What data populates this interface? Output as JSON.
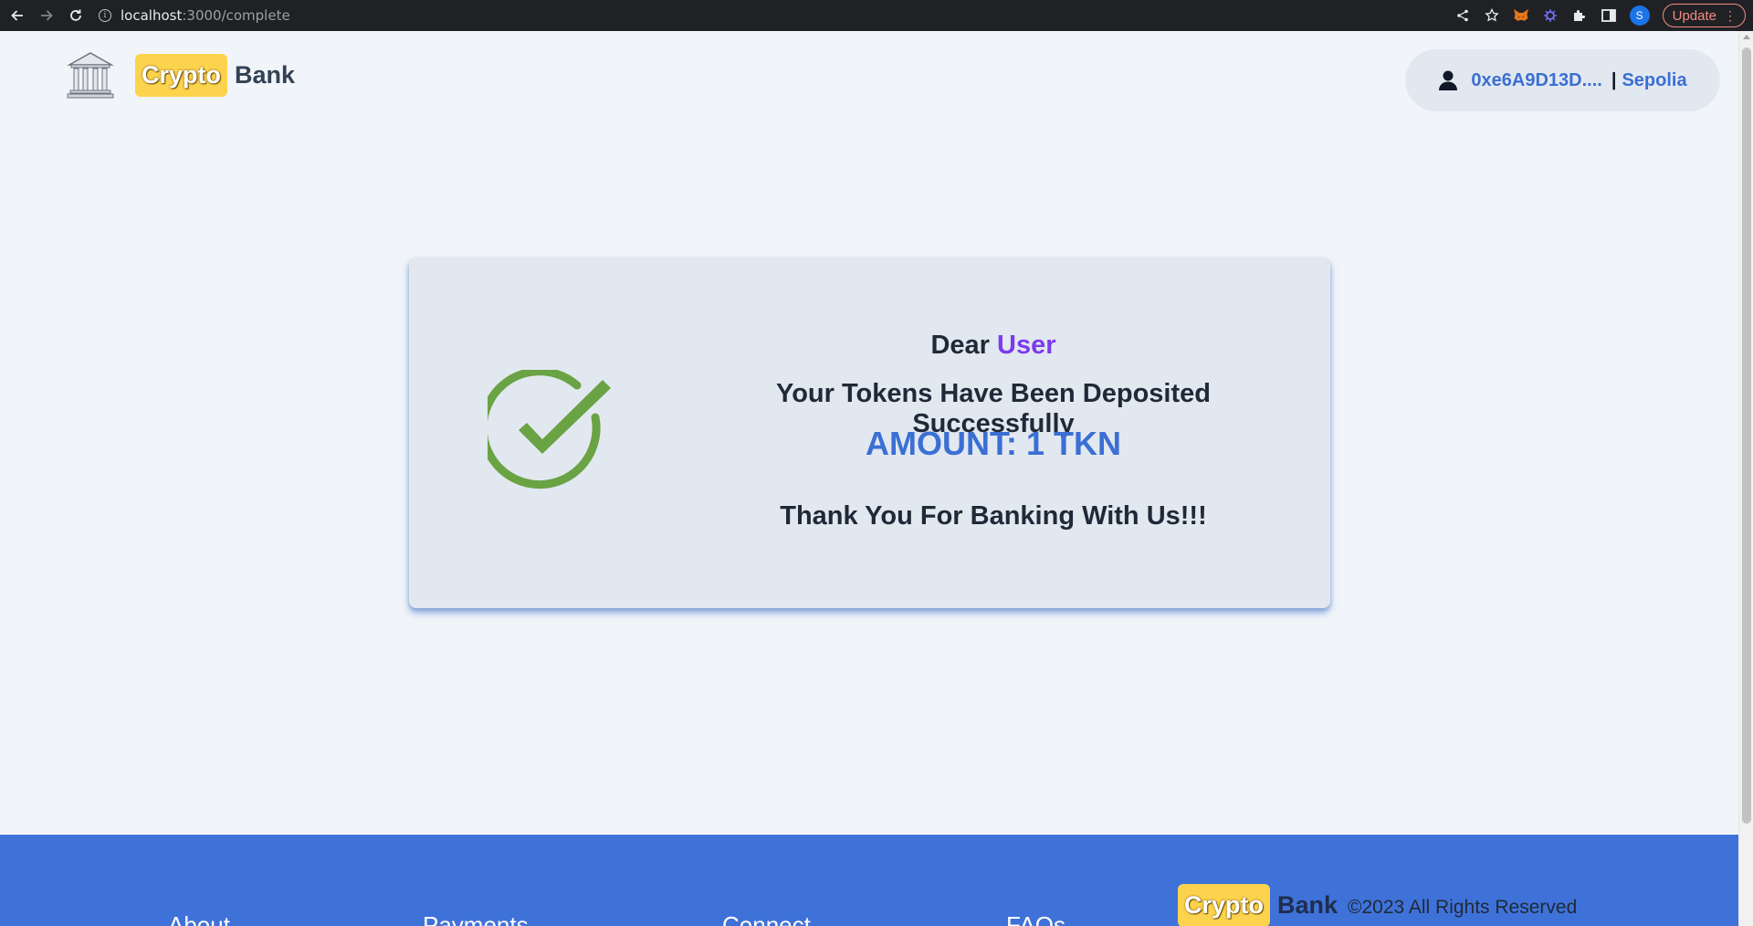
{
  "browser": {
    "url_host": "localhost",
    "url_path": ":3000/complete",
    "profile_initial": "S",
    "update_label": "Update"
  },
  "header": {
    "brand_crypto": "Crypto",
    "brand_bank": "Bank",
    "wallet_address": "0xe6A9D13D....",
    "wallet_separator": "|",
    "network": "Sepolia"
  },
  "card": {
    "greeting_prefix": "Dear",
    "greeting_name": "User",
    "message": "Your Tokens Have Been Deposited Successfully",
    "amount": "AMOUNT: 1 TKN",
    "thanks": "Thank You For Banking With Us!!!"
  },
  "footer": {
    "columns": [
      "About",
      "Payments",
      "Connect",
      "FAQs"
    ],
    "brand_crypto": "Crypto",
    "brand_bank": "Bank",
    "copyright": "©2023 All Rights Reserved"
  },
  "colors": {
    "accent_blue": "#3b6fd4",
    "footer_blue": "#3f72d9",
    "brand_yellow": "#fcd34d",
    "name_purple": "#7c3aed",
    "check_green": "#6aa343"
  }
}
